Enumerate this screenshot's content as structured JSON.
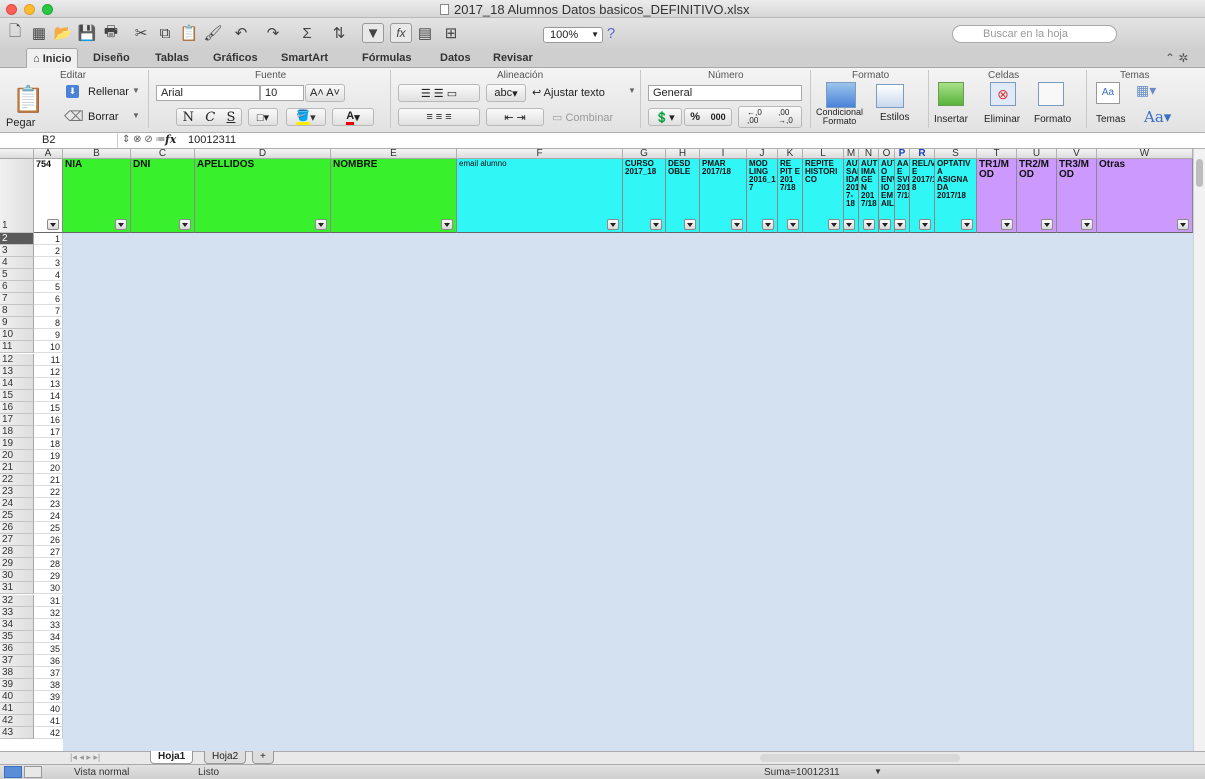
{
  "window": {
    "title": "2017_18 Alumnos Datos basicos_DEFINITIVO.xlsx"
  },
  "toolbar": {
    "zoom": "100%",
    "search_placeholder": "Buscar en la hoja"
  },
  "tabs": [
    "Inicio",
    "Diseño",
    "Tablas",
    "Gráficos",
    "SmartArt",
    "Fórmulas",
    "Datos",
    "Revisar"
  ],
  "ribbon": {
    "groups": {
      "editar": "Editar",
      "fuente": "Fuente",
      "alineacion": "Alineación",
      "numero": "Número",
      "formato": "Formato",
      "celdas": "Celdas",
      "temas": "Temas"
    },
    "pegar": "Pegar",
    "rellenar": "Rellenar",
    "borrar": "Borrar",
    "font_name": "Arial",
    "font_size": "10",
    "bold": "N",
    "italic": "C",
    "underline": "S",
    "abc": "abc",
    "ajustar": "Ajustar texto",
    "combinar": "Combinar",
    "number_format": "General",
    "percent": "%",
    "thousands": "000",
    "dec_inc": "←,0\n,00",
    "dec_dec": ",00\n→,0",
    "condicional": "Condicional\nFormato",
    "estilos": "Estilos",
    "insertar": "Insertar",
    "eliminar": "Eliminar",
    "formato": "Formato",
    "temas": "Temas",
    "aa": "Aa"
  },
  "formula_bar": {
    "cell": "B2",
    "fx": "fx",
    "value": "10012311"
  },
  "columns": [
    "A",
    "B",
    "C",
    "D",
    "E",
    "F",
    "G",
    "H",
    "I",
    "J",
    "K",
    "L",
    "M",
    "N",
    "O",
    "P",
    "R",
    "S",
    "T",
    "U",
    "V",
    "W"
  ],
  "header_row": {
    "A": "754",
    "B": "NIA",
    "C": "DNI",
    "D": "APELLIDOS",
    "E": "NOMBRE",
    "F": "email alumno",
    "G": "CURSO 2017_18",
    "H": "DESD OBLE",
    "I": "PMAR 2017/18",
    "J": "MOD LING 2016_1 7",
    "K": "RE PIT E 201 7/18",
    "L": "REPITE HISTORI CO",
    "M": "AUT SAL IDA 201 7-18",
    "N": "AUT IMA GE N 201 7/18",
    "O": "AUT O ENV IO EM AIL",
    "P": "AAE E SVR 201 7/18",
    "R": "REL/V E 2017/1 8",
    "S": "OPTATIV A ASIGNA DA 2017/18",
    "T": "TR1/M OD",
    "U": "TR2/M OD",
    "V": "TR3/M OD",
    "W": "Otras"
  },
  "row_numbers": [
    "1",
    "2",
    "3",
    "4",
    "5",
    "6",
    "7",
    "8",
    "9",
    "10",
    "11",
    "12",
    "13",
    "14",
    "15",
    "16",
    "17",
    "18",
    "19",
    "20",
    "21",
    "22",
    "23",
    "24",
    "25",
    "26",
    "27",
    "28",
    "29",
    "30",
    "31",
    "32",
    "33",
    "34",
    "35",
    "36",
    "37",
    "38",
    "39",
    "40",
    "41",
    "42",
    "43"
  ],
  "col_a_values": [
    "1",
    "2",
    "3",
    "4",
    "5",
    "6",
    "7",
    "8",
    "9",
    "10",
    "11",
    "12",
    "13",
    "14",
    "15",
    "16",
    "17",
    "18",
    "19",
    "20",
    "21",
    "22",
    "23",
    "24",
    "25",
    "26",
    "27",
    "28",
    "29",
    "30",
    "31",
    "32",
    "33",
    "34",
    "35",
    "36",
    "37",
    "38",
    "39",
    "40",
    "41",
    "42"
  ],
  "sheets": [
    "Hoja1",
    "Hoja2",
    "+"
  ],
  "status": {
    "view": "Vista normal",
    "ready": "Listo",
    "sum": "Suma=10012311"
  },
  "colors": {
    "green": "#39f02d",
    "cyan": "#30f6f6",
    "purple": "#cc99ff",
    "selection": "#d3e1f0"
  }
}
